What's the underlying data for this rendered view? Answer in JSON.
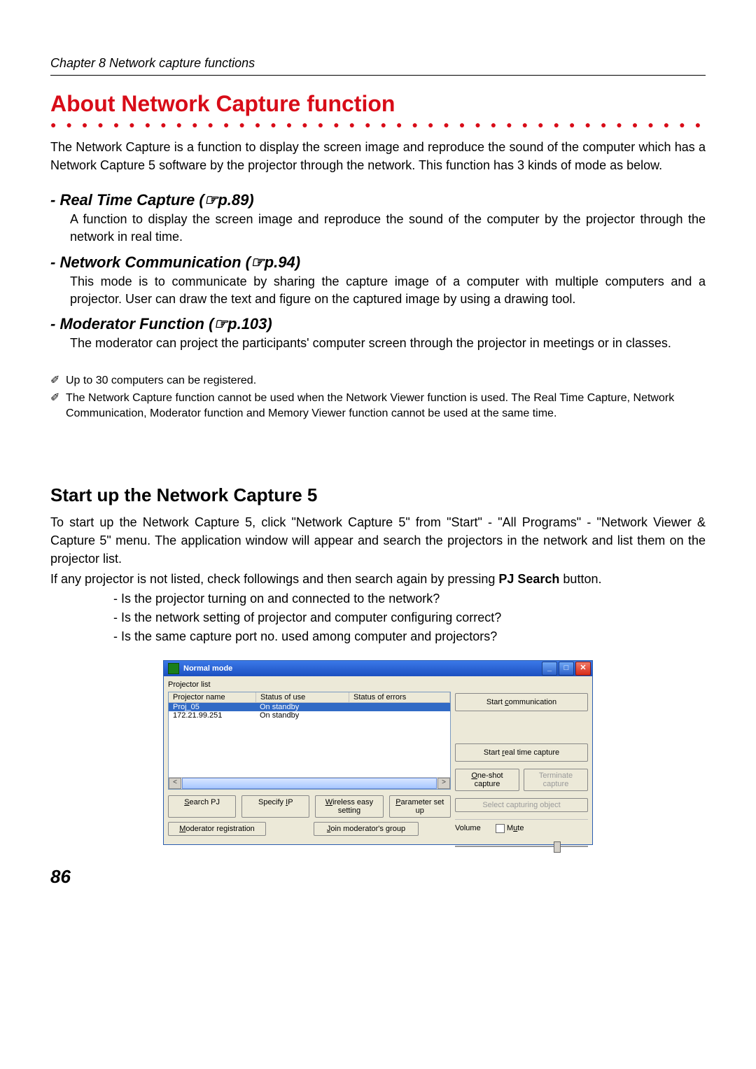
{
  "chapter": "Chapter 8 Network capture functions",
  "title": "About Network Capture function",
  "intro": "The Network Capture is a function to display the screen image and reproduce the sound of the computer which has a Network Capture 5 software by the projector through the network. This function has 3 kinds of mode as below.",
  "modes": [
    {
      "title": "- Real Time Capture (☞p.89)",
      "body": "A function to display the screen image and reproduce the sound of the computer by the projector through the network in real time."
    },
    {
      "title": "- Network Communication (☞p.94)",
      "body": "This mode is to communicate by sharing the capture image of a computer with multiple computers and a projector. User can draw the text and figure on the captured image by using a drawing tool."
    },
    {
      "title": "- Moderator Function (☞p.103)",
      "body": "The moderator can project the participants' computer screen through the projector in meetings or in classes."
    }
  ],
  "notes": [
    "Up to 30 computers can be registered.",
    "The Network  Capture function cannot be used when the Network Viewer function is used. The Real Time Capture, Network Communication, Moderator function and Memory Viewer function cannot be used at the same time."
  ],
  "section2_title": "Start up the Network Capture 5",
  "section2_p1": "To start up the Network Capture 5, click \"Network Capture 5\" from \"Start\" - \"All Programs\" - \"Network Viewer & Capture 5\" menu. The application window will appear and search the projectors in the network and list them on the projector list.",
  "section2_p2_prefix": "If any projector is not listed, check followings and then search again by pressing ",
  "section2_p2_bold": "PJ Search",
  "section2_p2_suffix": " button.",
  "checks": [
    "Is the projector turning on and connected to the network?",
    "Is the network setting of projector and computer configuring correct?",
    "Is the same capture port no. used among computer and projectors?"
  ],
  "window": {
    "title": "Normal mode",
    "list_label": "Projector list",
    "cols": [
      "Projector name",
      "Status of use",
      "Status of errors"
    ],
    "rows": [
      {
        "name": "Proj_05",
        "status": "On standby",
        "err": ""
      },
      {
        "name": "172.21.99.251",
        "status": "On standby",
        "err": ""
      }
    ],
    "btns": {
      "start_comm": "Start communication",
      "start_rtc": "Start real time capture",
      "oneshot": "One-shot capture",
      "terminate": "Terminate capture",
      "select_obj": "Select capturing object",
      "search_pj": "Search PJ",
      "specify_ip": "Specify IP",
      "wireless": "Wireless easy setting",
      "param": "Parameter set up",
      "mod_reg": "Moderator registration",
      "join_mod": "Join moderator's group"
    },
    "volume_label": "Volume",
    "mute_label": "Mute"
  },
  "page_number": "86"
}
